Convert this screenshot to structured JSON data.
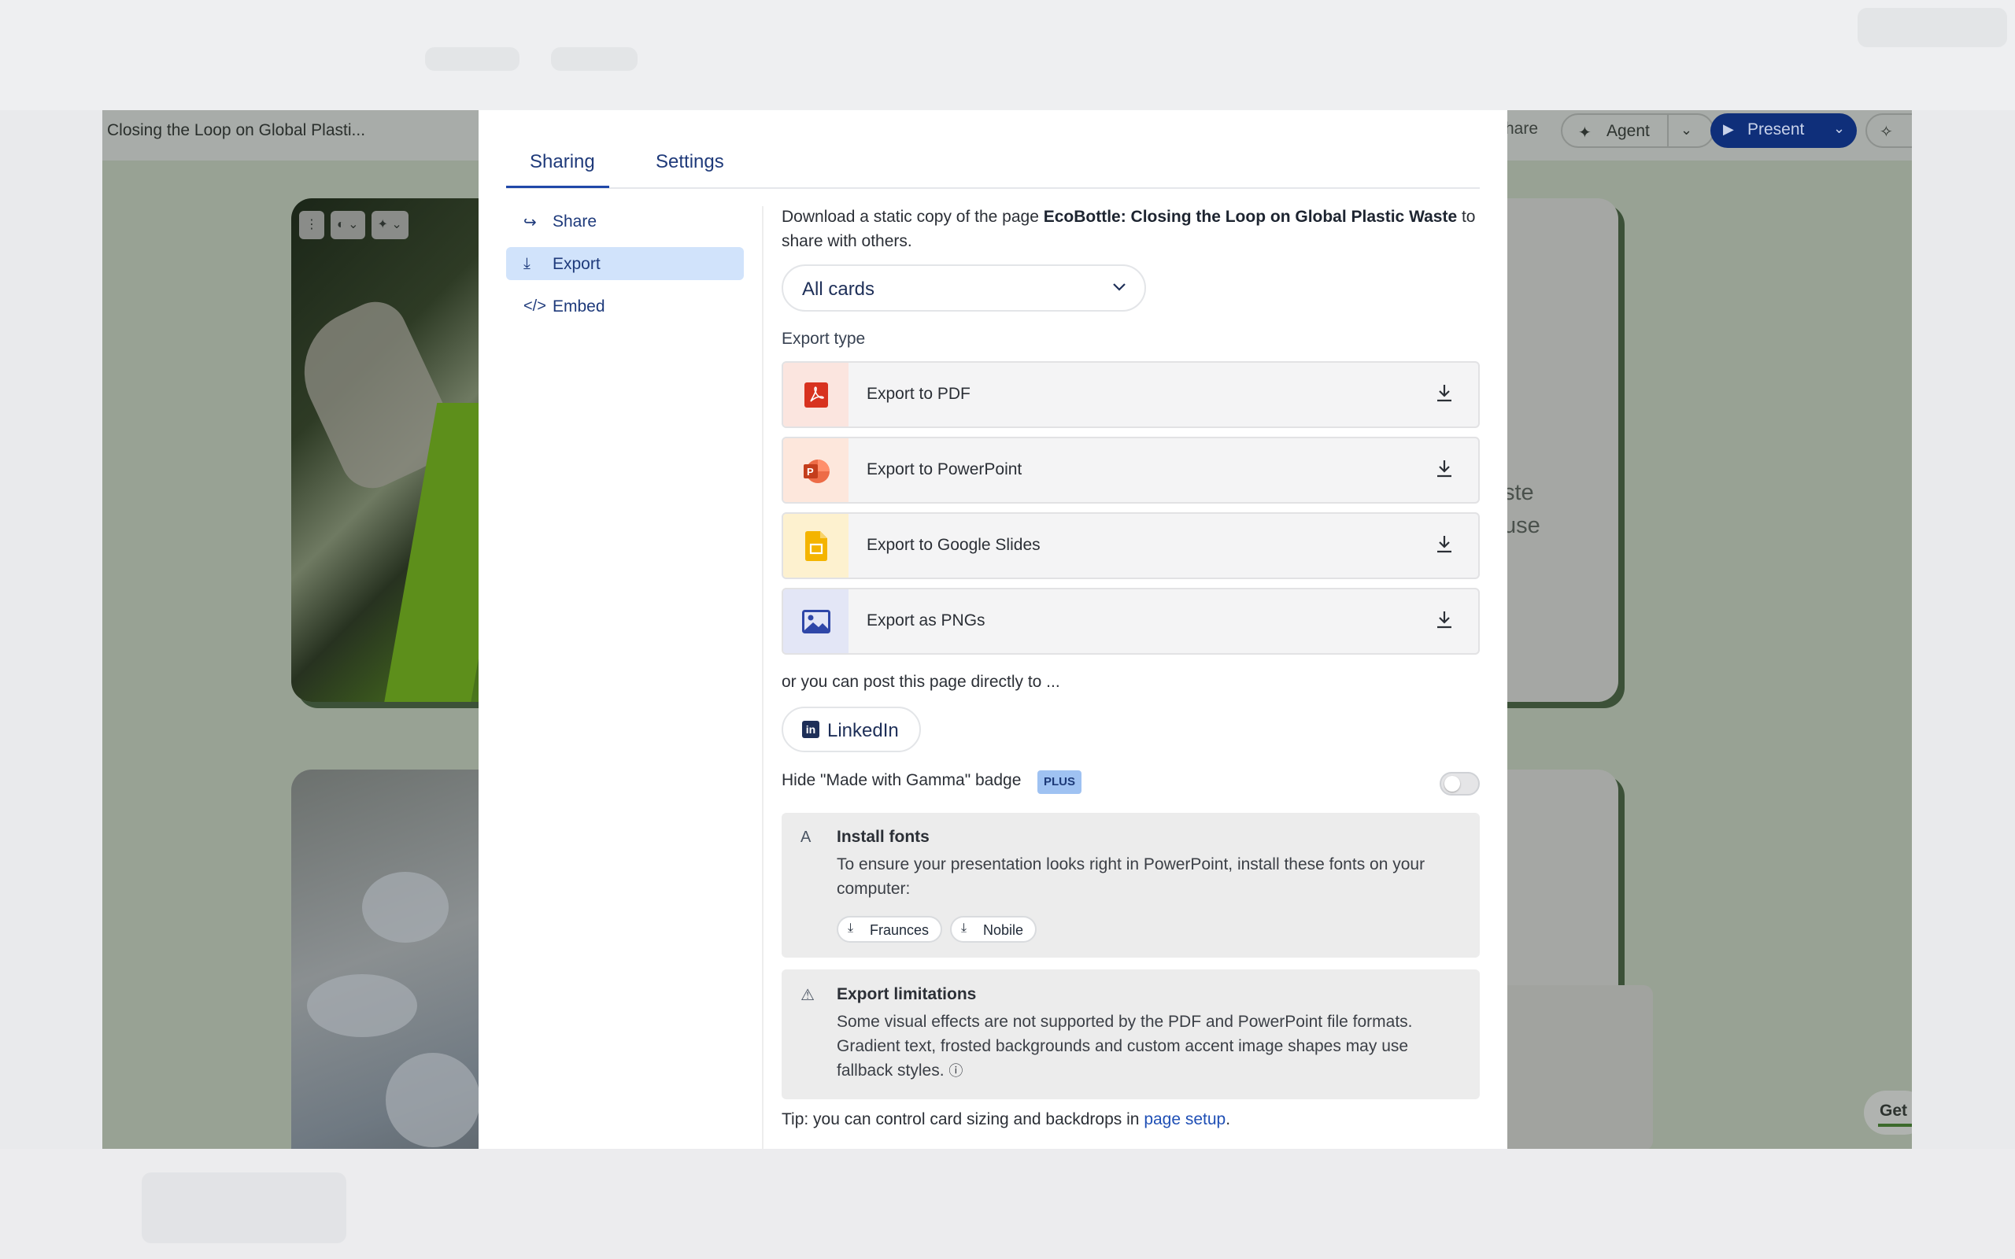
{
  "app": {
    "title": "Closing the Loop on Global Plasti...",
    "toolbar": {
      "share_label": "hare",
      "agent_label": "Agent",
      "present_label": "Present",
      "get_label": "Get"
    },
    "card1_text": [
      "ste",
      "use"
    ]
  },
  "modal": {
    "tabs": [
      {
        "label": "Sharing",
        "active": true
      },
      {
        "label": "Settings",
        "active": false
      }
    ],
    "nav": [
      {
        "label": "Share",
        "icon": "share-icon"
      },
      {
        "label": "Export",
        "icon": "download-icon",
        "active": true
      },
      {
        "label": "Embed",
        "icon": "code-icon"
      }
    ],
    "intro_prefix": "Download a static copy of the page ",
    "intro_bold": "EcoBottle: Closing the Loop on Global Plastic Waste",
    "intro_suffix": " to share with others.",
    "scope_select": "All cards",
    "export_type_label": "Export type",
    "export_options": [
      {
        "label": "Export to PDF",
        "icon": "pdf-icon"
      },
      {
        "label": "Export to PowerPoint",
        "icon": "powerpoint-icon"
      },
      {
        "label": "Export to Google Slides",
        "icon": "google-slides-icon"
      },
      {
        "label": "Export as PNGs",
        "icon": "image-icon"
      }
    ],
    "post_label": "or you can post this page directly to ...",
    "linkedin_label": "LinkedIn",
    "hide_badge_label": "Hide \"Made with Gamma\" badge",
    "plus_badge": "PLUS",
    "hide_badge_enabled": false,
    "install_fonts": {
      "title": "Install fonts",
      "body": "To ensure your presentation looks right in PowerPoint, install these fonts on your computer:",
      "fonts": [
        "Fraunces",
        "Nobile"
      ]
    },
    "export_limitations": {
      "title": "Export limitations",
      "body": "Some visual effects are not supported by the PDF and PowerPoint file formats. Gradient text, frosted backgrounds and custom accent image shapes may use fallback styles."
    },
    "tip_prefix": "Tip: you can control card sizing and backdrops in ",
    "tip_link": "page setup",
    "tip_suffix": "."
  },
  "colors": {
    "accent": "#2048a8",
    "nav_active_bg": "#d1e3fb",
    "present_button": "#0f2f7a",
    "plus_badge_bg": "#9fc2f2"
  }
}
